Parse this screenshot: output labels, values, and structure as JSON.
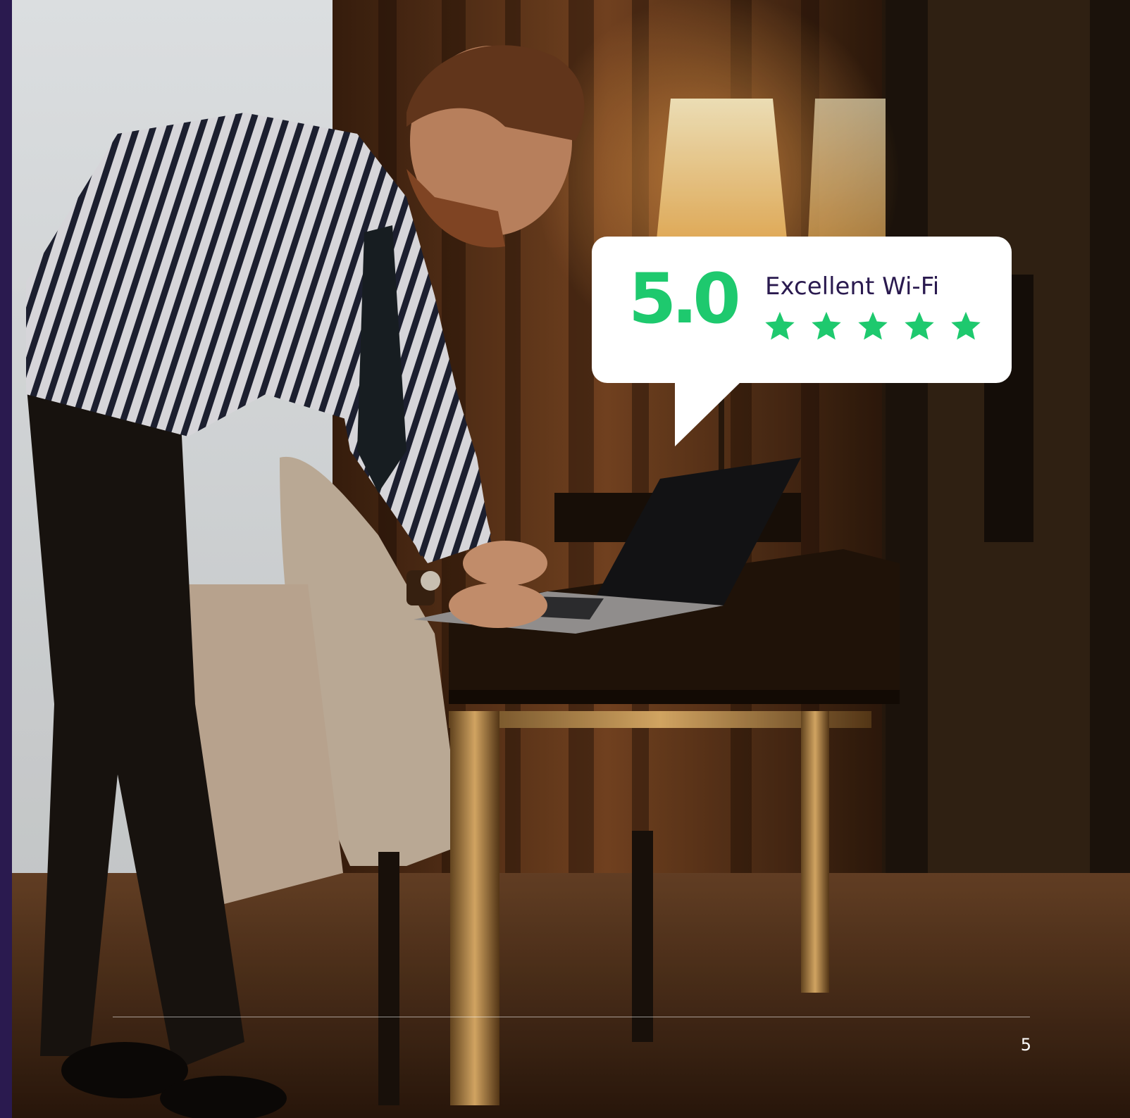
{
  "rating_card": {
    "score": "5.0",
    "label": "Excellent Wi-Fi",
    "star_count": 5,
    "star_color": "#1ec96e"
  },
  "footer": {
    "page_number": "5"
  },
  "colors": {
    "accent_bar": "#2a1a4f",
    "score_green": "#1ec96e",
    "label_purple": "#2a1a4f"
  }
}
